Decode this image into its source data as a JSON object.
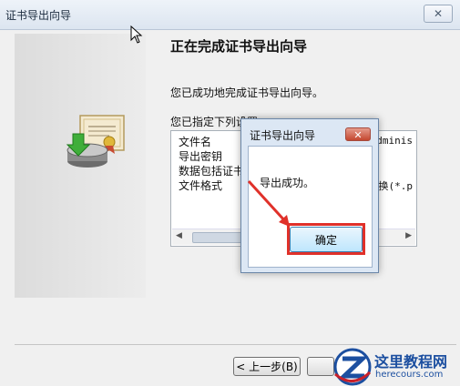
{
  "window": {
    "title": "证书导出向导",
    "close_label": "✕"
  },
  "page": {
    "heading": "正在完成证书导出向导",
    "description": "您已成功地完成证书导出向导。",
    "specified_label": "您已指定下列设置"
  },
  "settings": {
    "rows": [
      {
        "name": "文件名",
        "value": "Adminis"
      },
      {
        "name": "导出密钥",
        "value": ""
      },
      {
        "name": "数据包括证书",
        "value": ""
      },
      {
        "name": "文件格式",
        "value": "换(*.p"
      }
    ]
  },
  "footer": {
    "back_label": "< 上一步(B)"
  },
  "dialog": {
    "title": "证书导出向导",
    "close_label": "✕",
    "message": "导出成功。",
    "ok_label": "确定"
  },
  "watermark": {
    "line1": "这里教程网",
    "line2": "herecours.com"
  },
  "colors": {
    "highlight": "#e0312a",
    "accent": "#3c7fb1"
  }
}
